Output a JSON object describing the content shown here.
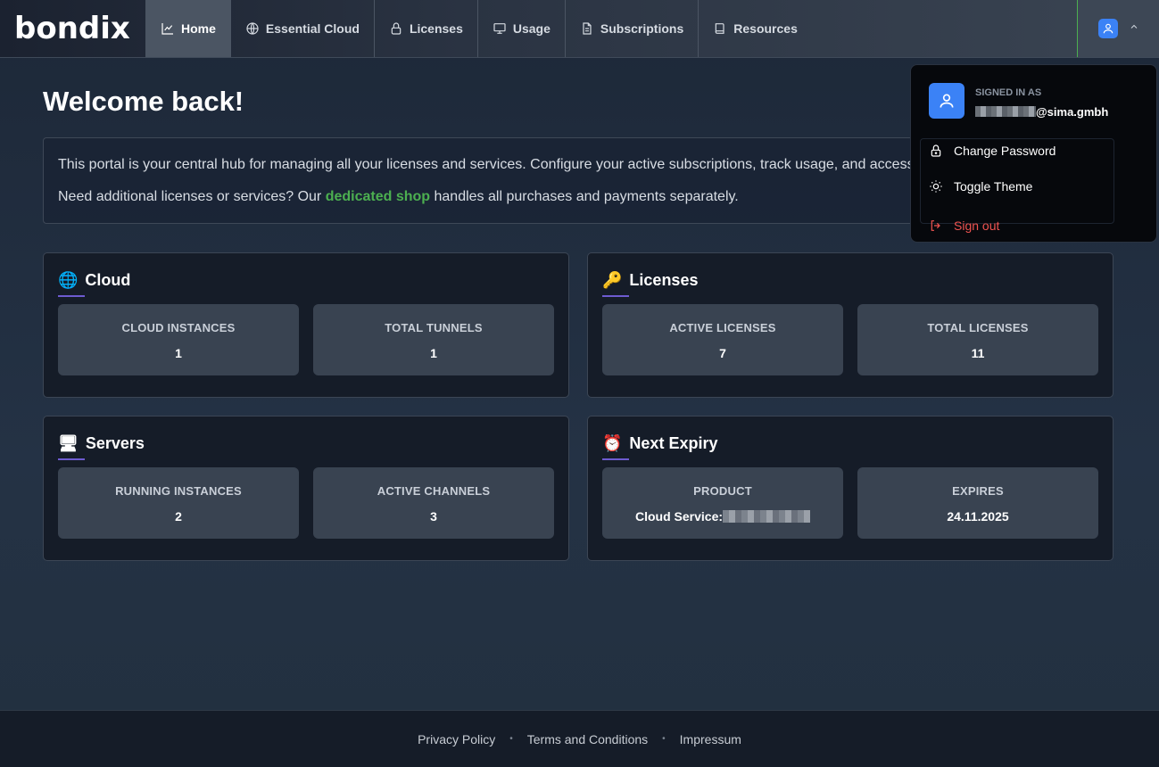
{
  "brand": {
    "logo_text": "bondix"
  },
  "nav": {
    "items": [
      {
        "label": "Home",
        "icon": "chart-line-icon",
        "active": true
      },
      {
        "label": "Essential Cloud",
        "icon": "globe-icon"
      },
      {
        "label": "Licenses",
        "icon": "lock-icon"
      },
      {
        "label": "Usage",
        "icon": "monitor-icon"
      },
      {
        "label": "Subscriptions",
        "icon": "document-icon"
      },
      {
        "label": "Resources",
        "icon": "book-icon"
      }
    ]
  },
  "main": {
    "title": "Welcome back!",
    "intro_line1": "This portal is your central hub for managing all your licenses and services. Configure your active subscriptions, track usage, and access your licenses.",
    "intro_line2_before": "Need additional licenses or services? Our ",
    "intro_link": "dedicated shop",
    "intro_line2_after": " handles all purchases and payments separately."
  },
  "cards": {
    "cloud": {
      "emoji": "🌐",
      "title": "Cloud",
      "stats": [
        {
          "label": "CLOUD INSTANCES",
          "value": "1"
        },
        {
          "label": "TOTAL TUNNELS",
          "value": "1"
        }
      ]
    },
    "licenses": {
      "emoji": "🔑",
      "title": "Licenses",
      "stats": [
        {
          "label": "ACTIVE LICENSES",
          "value": "7"
        },
        {
          "label": "TOTAL LICENSES",
          "value": "11"
        }
      ]
    },
    "servers": {
      "emoji": "🖥",
      "title": "Servers",
      "stats": [
        {
          "label": "RUNNING INSTANCES",
          "value": "2"
        },
        {
          "label": "ACTIVE CHANNELS",
          "value": "3"
        }
      ]
    },
    "expiry": {
      "emoji": "⏰",
      "title": "Next Expiry",
      "stats": [
        {
          "label": "PRODUCT",
          "value": "Cloud Service:"
        },
        {
          "label": "EXPIRES",
          "value": "24.11.2025"
        }
      ]
    }
  },
  "footer": {
    "links": [
      "Privacy Policy",
      "Terms and Conditions",
      "Impressum"
    ],
    "separator": "•"
  },
  "user_menu": {
    "signed_in_label": "SIGNED IN AS",
    "email_domain": "@sima.gmbh",
    "items": [
      {
        "label": "Change Password",
        "icon": "lock-icon"
      },
      {
        "label": "Toggle Theme",
        "icon": "sun-icon"
      },
      {
        "label": "Sign out",
        "icon": "sign-out-icon"
      }
    ]
  },
  "colors": {
    "accent_green": "#4caf50",
    "avatar_blue": "#3b82f6",
    "danger_red": "#ef5350",
    "underline_purple": "#6d5bd0"
  }
}
